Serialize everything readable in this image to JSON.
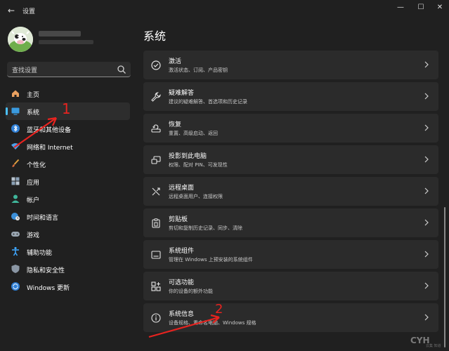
{
  "window": {
    "title": "设置",
    "back_glyph": "←",
    "minimize_glyph": "—",
    "maximize_glyph": "☐",
    "close_glyph": "✕"
  },
  "search": {
    "placeholder": "查找设置"
  },
  "sidebar": {
    "items": [
      {
        "label": "主页",
        "icon": "home-icon"
      },
      {
        "label": "系统",
        "icon": "system-icon",
        "active": true
      },
      {
        "label": "蓝牙和其他设备",
        "icon": "bluetooth-icon"
      },
      {
        "label": "网络和 Internet",
        "icon": "wifi-icon"
      },
      {
        "label": "个性化",
        "icon": "brush-icon"
      },
      {
        "label": "应用",
        "icon": "apps-icon"
      },
      {
        "label": "帐户",
        "icon": "account-icon"
      },
      {
        "label": "时间和语言",
        "icon": "globe-clock-icon"
      },
      {
        "label": "游戏",
        "icon": "gamepad-icon"
      },
      {
        "label": "辅助功能",
        "icon": "accessibility-icon"
      },
      {
        "label": "隐私和安全性",
        "icon": "shield-icon"
      },
      {
        "label": "Windows 更新",
        "icon": "update-icon"
      }
    ]
  },
  "main": {
    "title": "系统",
    "cards": [
      {
        "title": "激活",
        "subtitle": "激活状态、订阅、产品密钥",
        "icon": "activation-icon"
      },
      {
        "title": "疑难解答",
        "subtitle": "建议的疑难解答、首选项和历史记录",
        "icon": "wrench-icon"
      },
      {
        "title": "恢复",
        "subtitle": "重置、高级启动、返回",
        "icon": "recovery-icon"
      },
      {
        "title": "投影到此电脑",
        "subtitle": "权限、配对 PIN、可发现性",
        "icon": "project-icon"
      },
      {
        "title": "远程桌面",
        "subtitle": "远程桌面用户、连接权限",
        "icon": "remote-icon"
      },
      {
        "title": "剪贴板",
        "subtitle": "剪切和复制历史记录、同步、清除",
        "icon": "clipboard-icon"
      },
      {
        "title": "系统组件",
        "subtitle": "管理在 Windows 上预安装的系统组件",
        "icon": "components-icon"
      },
      {
        "title": "可选功能",
        "subtitle": "你的设备的额外功能",
        "icon": "optional-features-icon"
      },
      {
        "title": "系统信息",
        "subtitle": "设备规格、重命名电脑、Windows 规格",
        "icon": "info-icon"
      }
    ]
  },
  "annotations": {
    "mark1": "1",
    "mark2": "2"
  },
  "watermark": {
    "main": "CYH",
    "sub": "云集 知道"
  },
  "colors": {
    "accent": "#4cc2ff",
    "annotation": "#e8231f",
    "card": "#2b2b2b",
    "background": "#202020"
  }
}
